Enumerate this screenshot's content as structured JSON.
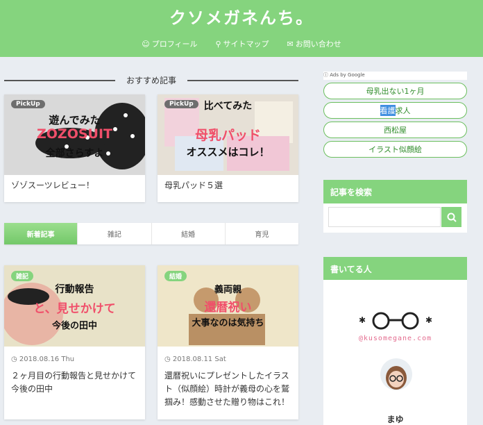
{
  "header": {
    "logo": "クソメガネんち。",
    "nav": [
      {
        "label": "プロフィール",
        "icon": "user-icon"
      },
      {
        "label": "サイトマップ",
        "icon": "pin-icon"
      },
      {
        "label": "お問い合わせ",
        "icon": "mail-icon"
      }
    ]
  },
  "recommended": {
    "title": "おすすめ記事",
    "items": [
      {
        "badge": "PickUp",
        "thumb_lines": [
          "遊んでみた",
          "ZOZOSUIT",
          "全部さらすよ"
        ],
        "title": "ゾゾスーツレビュー！"
      },
      {
        "badge": "PickUp",
        "thumb_lines": [
          "比べてみた",
          "母乳パッド",
          "オススメはコレ！"
        ],
        "title": "母乳パッド５選"
      }
    ]
  },
  "tabs": [
    "新着記事",
    "雑記",
    "結婚",
    "育児"
  ],
  "articles": [
    {
      "badge": "雑記",
      "thumb_lines": [
        "行動報告",
        "と、見せかけて",
        "今後の田中"
      ],
      "date": "2018.08.16 Thu",
      "title": "２ヶ月目の行動報告と見せかけて今後の田中"
    },
    {
      "badge": "結婚",
      "thumb_lines": [
        "義両親",
        "還暦祝い",
        "大事なのは気持ち"
      ],
      "date": "2018.08.11 Sat",
      "title": "還暦祝いにプレゼントしたイラスト（似顔絵）時計が義母の心を鷲掴み！感動させた贈り物はこれ！"
    }
  ],
  "sidebar": {
    "ads_label": "Ads by Google",
    "ad_links": [
      "母乳出ない1ヶ月",
      "求人",
      "西松屋",
      "イラスト似顔絵"
    ],
    "ad_link_highlight": "看護",
    "search_title": "記事を検索",
    "author_title": "書いてる人",
    "site_url": "@kusomegane.com",
    "author_name": "まゆ"
  },
  "colors": {
    "brand": "#85d47e",
    "badge": "#85d47e",
    "pickup_badge": "#6e6e6e",
    "accent_red": "#f04f6a"
  }
}
